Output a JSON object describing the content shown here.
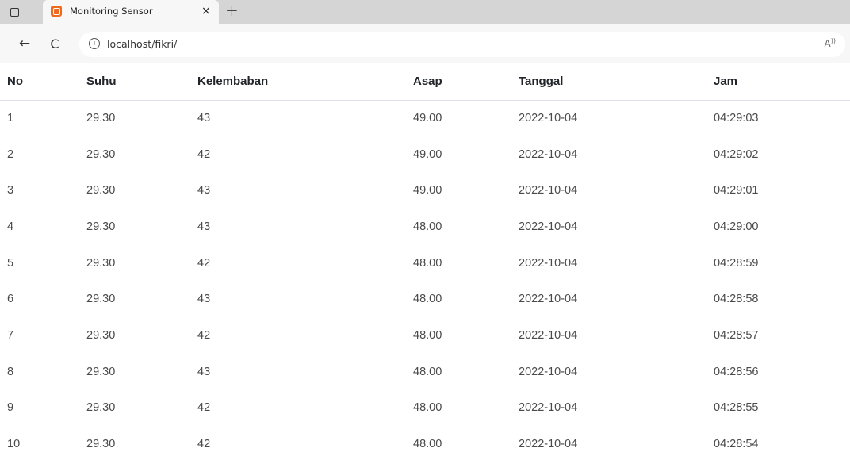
{
  "browser": {
    "tab_title": "Monitoring Sensor",
    "tab_close": "×",
    "new_tab": "+",
    "back": "←",
    "refresh": "C",
    "url": "localhost/fikri/",
    "info": "i",
    "read_aloud": "A"
  },
  "table": {
    "headers": [
      "No",
      "Suhu",
      "Kelembaban",
      "Asap",
      "Tanggal",
      "Jam"
    ],
    "rows": [
      [
        "1",
        "29.30",
        "43",
        "49.00",
        "2022-10-04",
        "04:29:03"
      ],
      [
        "2",
        "29.30",
        "42",
        "49.00",
        "2022-10-04",
        "04:29:02"
      ],
      [
        "3",
        "29.30",
        "43",
        "49.00",
        "2022-10-04",
        "04:29:01"
      ],
      [
        "4",
        "29.30",
        "43",
        "48.00",
        "2022-10-04",
        "04:29:00"
      ],
      [
        "5",
        "29.30",
        "42",
        "48.00",
        "2022-10-04",
        "04:28:59"
      ],
      [
        "6",
        "29.30",
        "43",
        "48.00",
        "2022-10-04",
        "04:28:58"
      ],
      [
        "7",
        "29.30",
        "42",
        "48.00",
        "2022-10-04",
        "04:28:57"
      ],
      [
        "8",
        "29.30",
        "43",
        "48.00",
        "2022-10-04",
        "04:28:56"
      ],
      [
        "9",
        "29.30",
        "42",
        "48.00",
        "2022-10-04",
        "04:28:55"
      ],
      [
        "10",
        "29.30",
        "42",
        "48.00",
        "2022-10-04",
        "04:28:54"
      ]
    ]
  }
}
